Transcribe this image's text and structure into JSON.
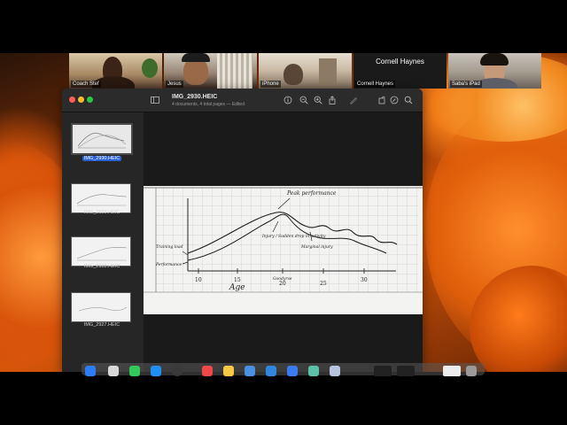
{
  "meeting": {
    "participants": [
      {
        "name": "Coach Stef"
      },
      {
        "name": "Jesus"
      },
      {
        "name": "iPhone"
      },
      {
        "name": "Cornell Haynes",
        "banner": "Cornell Haynes"
      },
      {
        "name": "Saba's iPad"
      }
    ]
  },
  "preview_window": {
    "title": "IMG_2930.HEIC",
    "subtitle": "4 documents, 4 total pages — Edited",
    "toolbar": [
      "sidebar-icon",
      "info-icon",
      "zoom-out-icon",
      "zoom-in-icon",
      "share-icon",
      "markup-icon",
      "rotate-icon",
      "markup-toolbar-icon",
      "search-icon"
    ],
    "thumbnails": [
      {
        "label": "IMG_2930.HEIC",
        "selected": true
      },
      {
        "label": "IMG_2929.HEIC",
        "selected": false
      },
      {
        "label": "IMG_2928.HEIC",
        "selected": false
      },
      {
        "label": "IMG_2927.HEIC",
        "selected": false
      }
    ]
  },
  "sketch": {
    "title": "Peak performance",
    "xlabel": "Age",
    "ylabel_top": "Training load",
    "ylabel_bottom": "Performance",
    "x_ticks": [
      "10",
      "15",
      "20",
      "25",
      "30"
    ],
    "annotation_1": "Injury / Sudden drop in activity",
    "annotation_2": "Marginal injury",
    "annotation_3": "Goodyrse"
  },
  "colors": {
    "accent": "#2a62d6",
    "window_bg": "#1e1e1e"
  }
}
